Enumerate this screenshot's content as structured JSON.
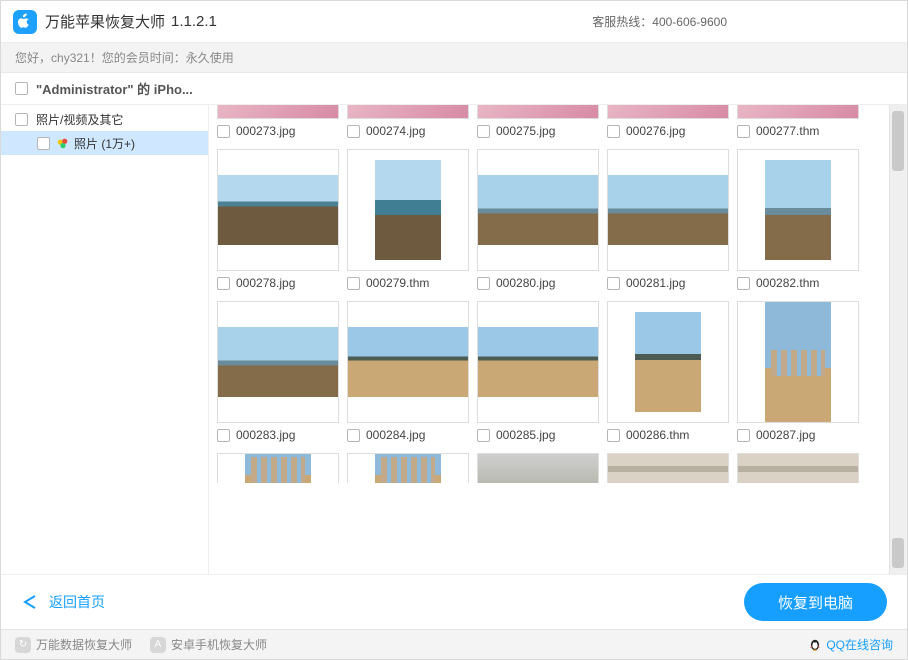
{
  "titlebar": {
    "app_name": "万能苹果恢复大师",
    "version": "1.1.2.1",
    "hotline_label": "客服热线：",
    "hotline_number": "400-606-9600"
  },
  "userbar": {
    "greeting_prefix": "您好，",
    "username": "chy321",
    "membership_label": "！您的会员时间：",
    "membership_value": "永久使用"
  },
  "device": {
    "label": "\"Administrator\" 的 iPho..."
  },
  "sidebar": {
    "category_label": "照片/视频及其它",
    "photos_label": "照片 (1万+)"
  },
  "grid_rows": [
    {
      "type": "partial",
      "items": [
        {
          "file": "000273.jpg",
          "scene": "pink"
        },
        {
          "file": "000274.jpg",
          "scene": "pink"
        },
        {
          "file": "000275.jpg",
          "scene": "pink"
        },
        {
          "file": "000276.jpg",
          "scene": "pink"
        },
        {
          "file": "000277.thm",
          "scene": "pink"
        }
      ]
    },
    {
      "type": "full",
      "items": [
        {
          "file": "000278.jpg",
          "scene": "sea"
        },
        {
          "file": "000279.thm",
          "scene": "sea-t"
        },
        {
          "file": "000280.jpg",
          "scene": "coast"
        },
        {
          "file": "000281.jpg",
          "scene": "coast"
        },
        {
          "file": "000282.thm",
          "scene": "coast-t"
        }
      ]
    },
    {
      "type": "full",
      "items": [
        {
          "file": "000283.jpg",
          "scene": "coast"
        },
        {
          "file": "000284.jpg",
          "scene": "beach"
        },
        {
          "file": "000285.jpg",
          "scene": "beach"
        },
        {
          "file": "000286.thm",
          "scene": "beach-t"
        },
        {
          "file": "000287.jpg",
          "scene": "city"
        }
      ]
    },
    {
      "type": "cut",
      "items": [
        {
          "file": "",
          "scene": "city"
        },
        {
          "file": "",
          "scene": "city"
        },
        {
          "file": "",
          "scene": "road"
        },
        {
          "file": "",
          "scene": "shadow"
        },
        {
          "file": "",
          "scene": "shadow"
        }
      ]
    }
  ],
  "footer": {
    "back_label": "返回首页",
    "recover_label": "恢复到电脑"
  },
  "strip": {
    "link1": "万能数据恢复大师",
    "link2": "安卓手机恢复大师",
    "qq_label": "QQ在线咨询"
  }
}
